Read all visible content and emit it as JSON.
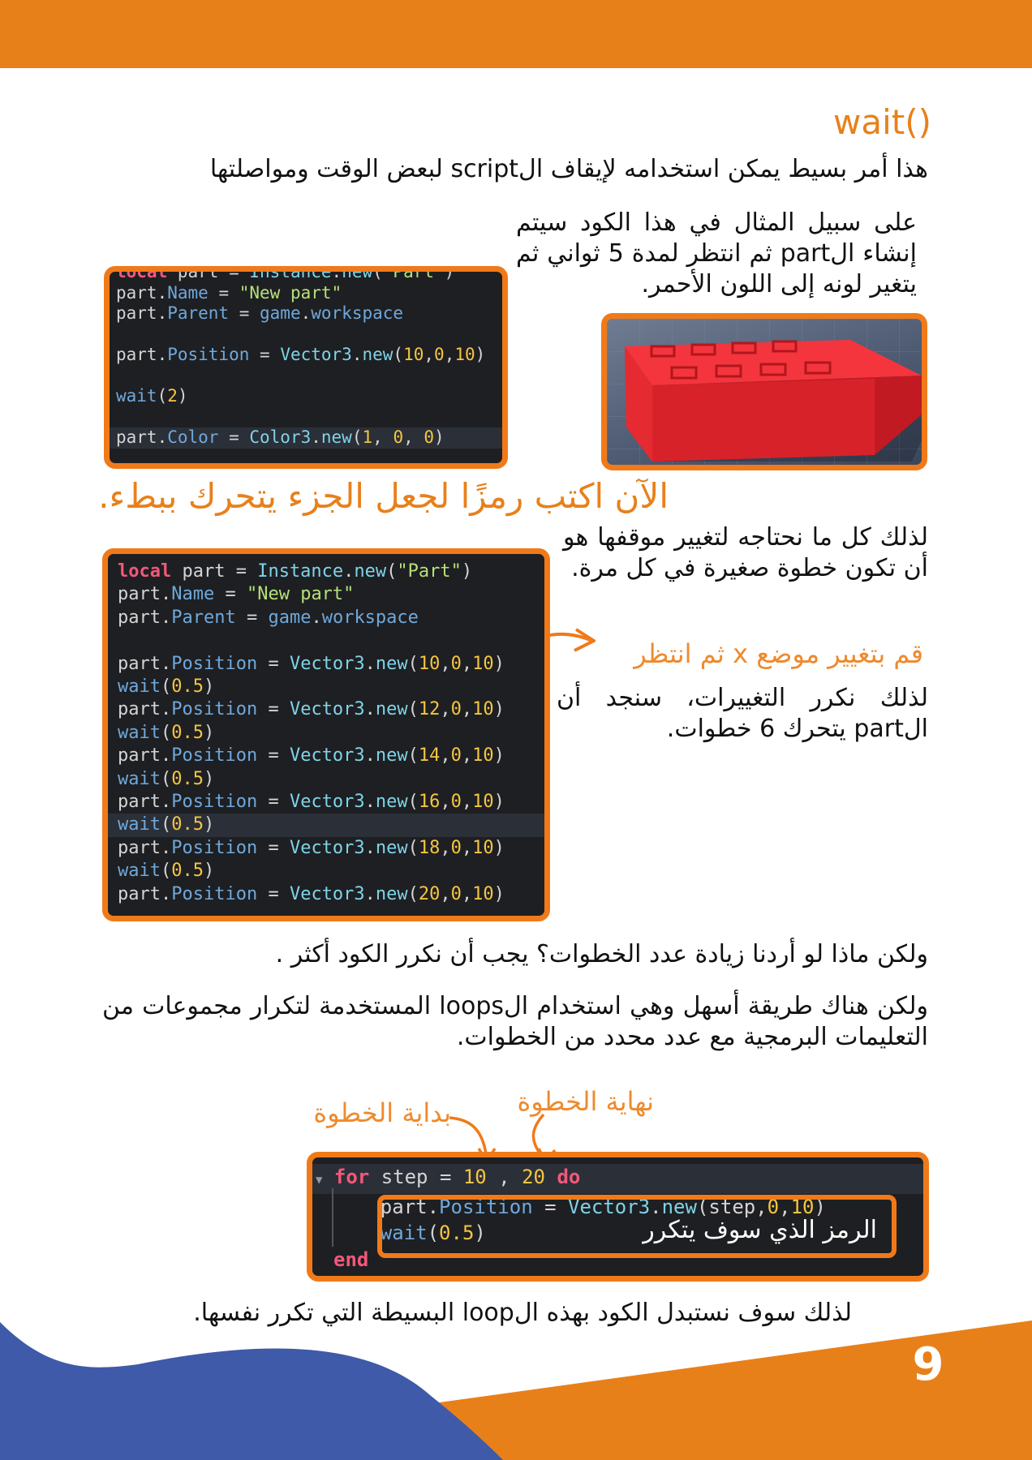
{
  "section": {
    "title": "wait()",
    "intro": "هذا أمر بسيط يمكن استخدامه لإيقاف الscript لبعض الوقت ومواصلتها",
    "example_text": "على سبيل المثال في هذا الكود سيتم إنشاء الpart ثم انتظر لمدة 5 ثواني ثم يتغير لونه إلى اللون الأحمر."
  },
  "code1": {
    "lines": [
      "local part = Instance.new(\"Part\")",
      "part.Name = \"New part\"",
      "part.Parent = game.workspace",
      "",
      "part.Position = Vector3.new(10,0,10)",
      "",
      "wait(2)",
      "",
      "part.Color = Color3.new(1, 0, 0)"
    ]
  },
  "heading2": "الآن اكتب رمزًا لجعل الجزء يتحرك ببطء.",
  "explain1": "لذلك كل ما نحتاجه لتغيير موقفها هو أن تكون خطوة صغيرة في كل مرة.",
  "annotation1": "قم بتغيير موضع x ثم انتظر",
  "explain2": "لذلك نكرر التغييرات، سنجد أن الpart يتحرك 6 خطوات.",
  "code2": {
    "lines": [
      "local part = Instance.new(\"Part\")",
      "part.Name = \"New part\"",
      "part.Parent = game.workspace",
      "",
      "part.Position = Vector3.new(10,0,10)",
      "wait(0.5)",
      "part.Position = Vector3.new(12,0,10)",
      "wait(0.5)",
      "part.Position = Vector3.new(14,0,10)",
      "wait(0.5)",
      "part.Position = Vector3.new(16,0,10)",
      "wait(0.5)",
      "part.Position = Vector3.new(18,0,10)",
      "wait(0.5)",
      "part.Position = Vector3.new(20,0,10)"
    ]
  },
  "paragraph1": "ولكن ماذا لو أردنا زيادة عدد الخطوات؟ يجب أن نكرر الكود أكثر .",
  "paragraph2": "ولكن هناك طريقة أسهل وهي استخدام الloops المستخدمة لتكرار مجموعات من التعليمات البرمجية مع عدد محدد من الخطوات.",
  "labels": {
    "step_end": "نهاية الخطوة",
    "step_start": "بداية الخطوة",
    "repeated_code": "الرمز الذي سوف يتكرر"
  },
  "code3": {
    "lines": [
      "for step = 10 , 20 do",
      "    part.Position = Vector3.new(step,0,10)",
      "    wait(0.5)",
      "end"
    ]
  },
  "conclusion": "لذلك سوف نستبدل الكود بهذه الloop البسيطة التي تكرر نفسها.",
  "page_number": "9",
  "colors": {
    "accent": "#e8801a",
    "blue": "#3f5aa8",
    "code_bg": "#1e1f22"
  }
}
